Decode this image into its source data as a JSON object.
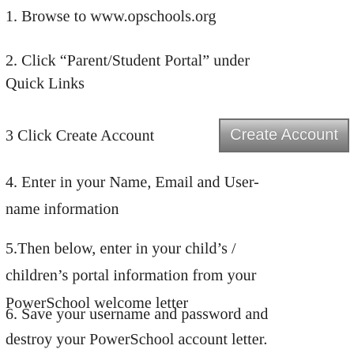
{
  "steps": {
    "step1": "1. Browse to www.opschools.org",
    "step2_line1": "2. Click “Parent/Student Portal” under",
    "step2_line2": "Quick Links",
    "step3": "3 Click Create Account",
    "step4_line1": "4. Enter in your Name, Email and User-",
    "step4_line2": "name information",
    "step5_line1": "5.Then below, enter in your child’s /",
    "step5_line2": "children’s portal information from your",
    "step5_line3": "PowerSchool welcome letter",
    "step6_line1": "6. Save your username and password and",
    "step6_line2": "destroy your PowerSchool account letter."
  },
  "create_account_button": {
    "label": "Create Account"
  }
}
